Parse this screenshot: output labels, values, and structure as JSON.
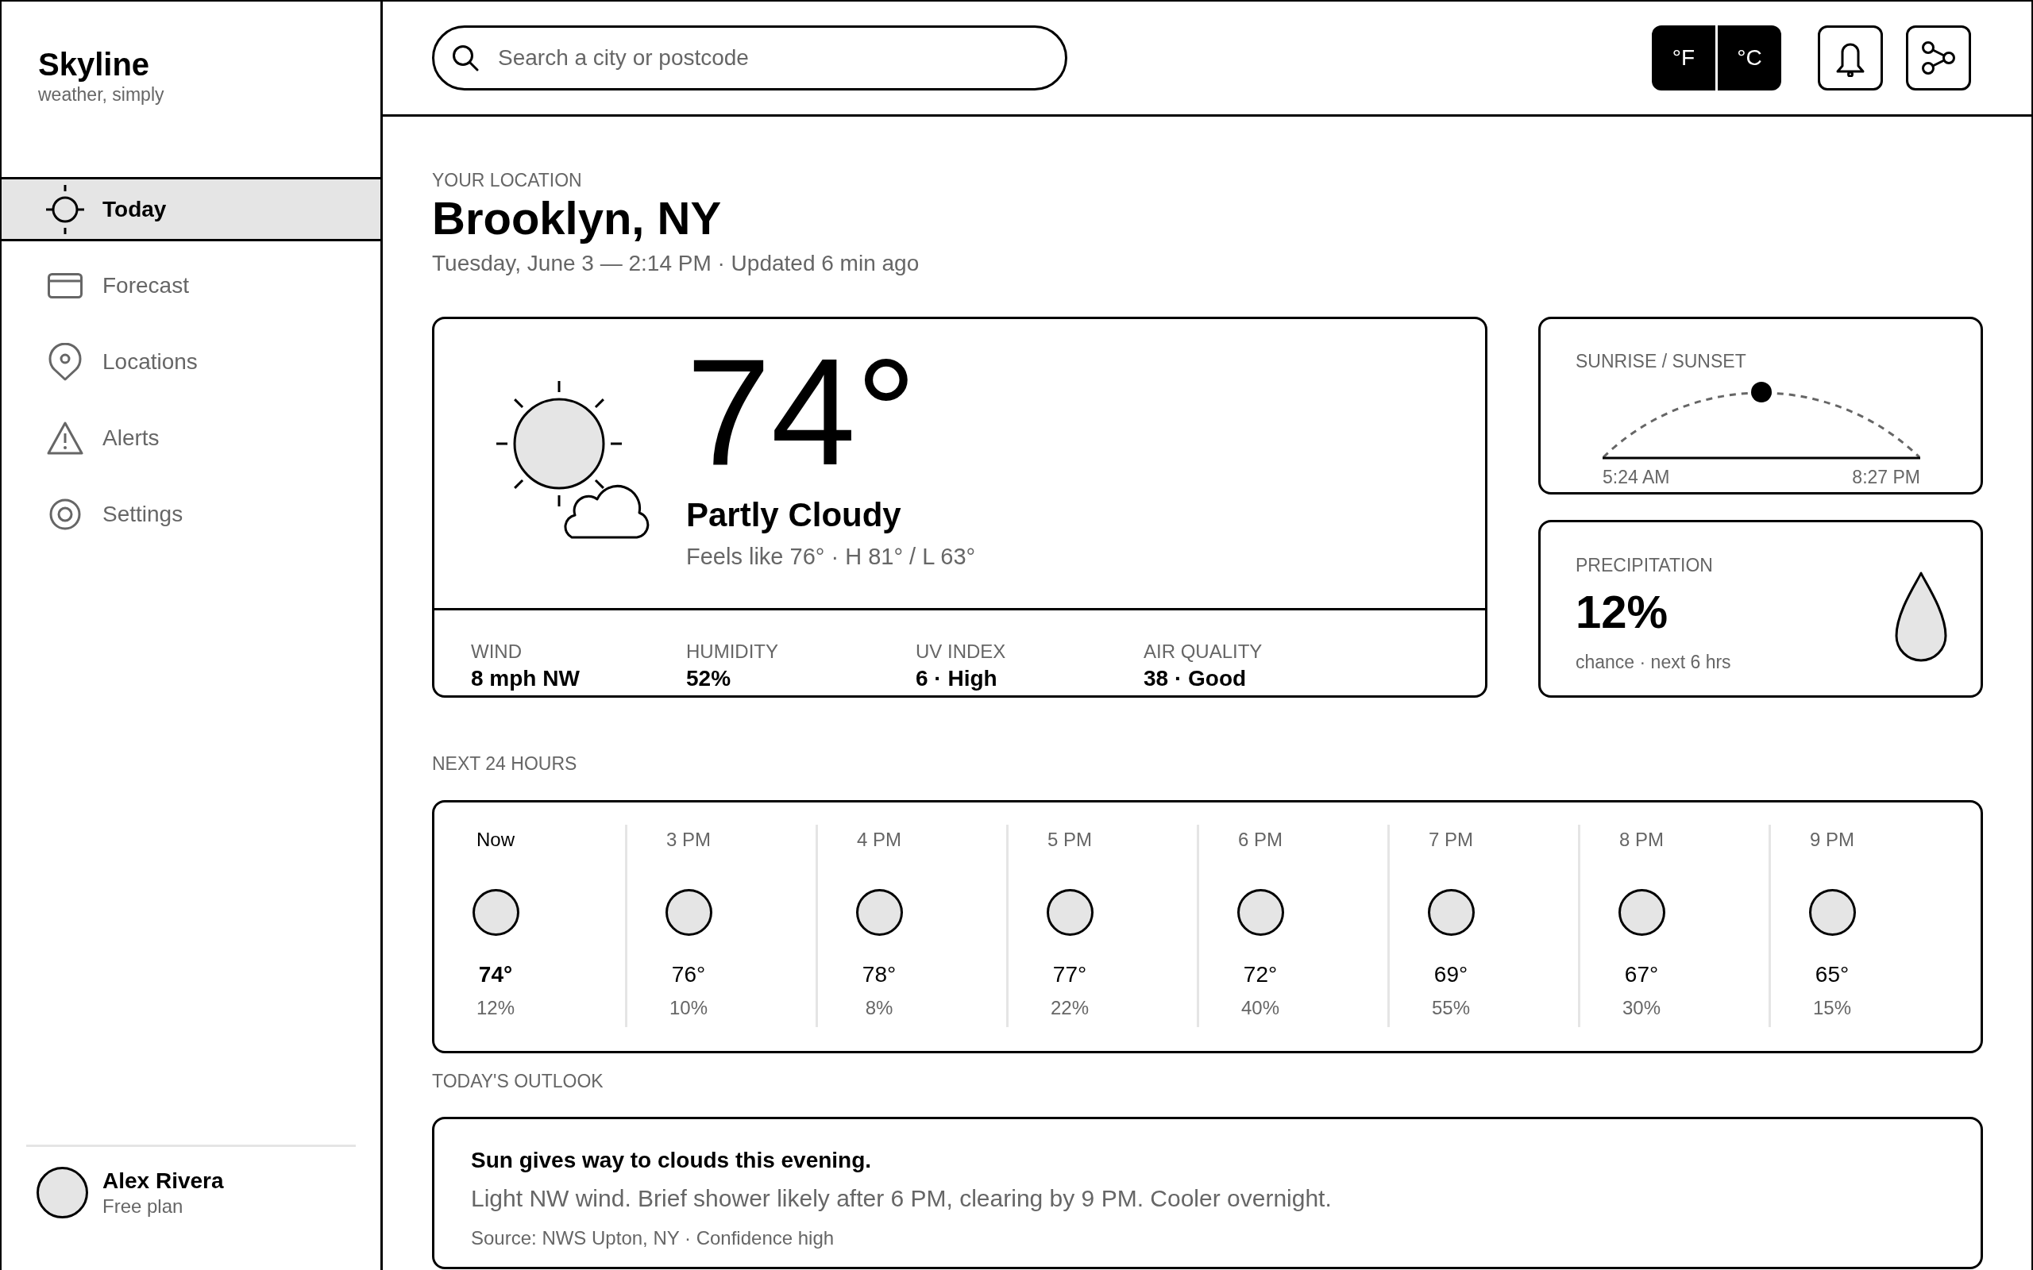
{
  "app": {
    "name": "Skyline",
    "tagline": "weather, simply"
  },
  "nav": [
    {
      "label": "Today",
      "selected": true
    },
    {
      "label": "Forecast",
      "selected": false
    },
    {
      "label": "Locations",
      "selected": false
    },
    {
      "label": "Alerts",
      "selected": false
    },
    {
      "label": "Settings",
      "selected": false
    }
  ],
  "user": {
    "name": "Alex Rivera",
    "plan": "Free plan"
  },
  "search": {
    "placeholder": "Search a city or postcode"
  },
  "units": [
    "°F",
    "°C"
  ],
  "location": {
    "label": "YOUR LOCATION",
    "name": "Brooklyn, NY",
    "updated": "Tuesday, June 3 — 2:14 PM · Updated 6 min ago"
  },
  "current": {
    "temperature": "74°",
    "condition": "Partly Cloudy",
    "details": "Feels like 76° · H 81° / L 63°",
    "stats": [
      {
        "label": "WIND",
        "value": "8 mph NW"
      },
      {
        "label": "HUMIDITY",
        "value": "52%"
      },
      {
        "label": "UV INDEX",
        "value": "6 · High"
      },
      {
        "label": "AIR QUALITY",
        "value": "38 · Good"
      }
    ]
  },
  "sun": {
    "title": "SUNRISE / SUNSET",
    "level": 0.5,
    "sunrise": "5:24 AM",
    "sunset": "8:27 PM"
  },
  "precipitation": {
    "title": "PRECIPITATION",
    "value": "12%",
    "caption": "chance · next 6 hrs"
  },
  "hourly": {
    "title": "NEXT 24 HOURS",
    "hours": [
      {
        "time": "Now",
        "temperature": "74°",
        "precipitation": "12%",
        "selected": true
      },
      {
        "time": "3 PM",
        "temperature": "76°",
        "precipitation": "10%",
        "selected": false
      },
      {
        "time": "4 PM",
        "temperature": "78°",
        "precipitation": "8%",
        "selected": false
      },
      {
        "time": "5 PM",
        "temperature": "77°",
        "precipitation": "22%",
        "selected": false
      },
      {
        "time": "6 PM",
        "temperature": "72°",
        "precipitation": "40%",
        "selected": false
      },
      {
        "time": "7 PM",
        "temperature": "69°",
        "precipitation": "55%",
        "selected": false
      },
      {
        "time": "8 PM",
        "temperature": "67°",
        "precipitation": "30%",
        "selected": false
      },
      {
        "time": "9 PM",
        "temperature": "65°",
        "precipitation": "15%",
        "selected": false
      }
    ]
  },
  "outlook": {
    "title": "TODAY'S OUTLOOK",
    "headline": "Sun gives way to clouds this evening.",
    "body": "Light NW wind. Brief shower likely after 6 PM, clearing by 9 PM. Cooler overnight.",
    "source": "Source: NWS Upton, NY · Confidence high"
  }
}
